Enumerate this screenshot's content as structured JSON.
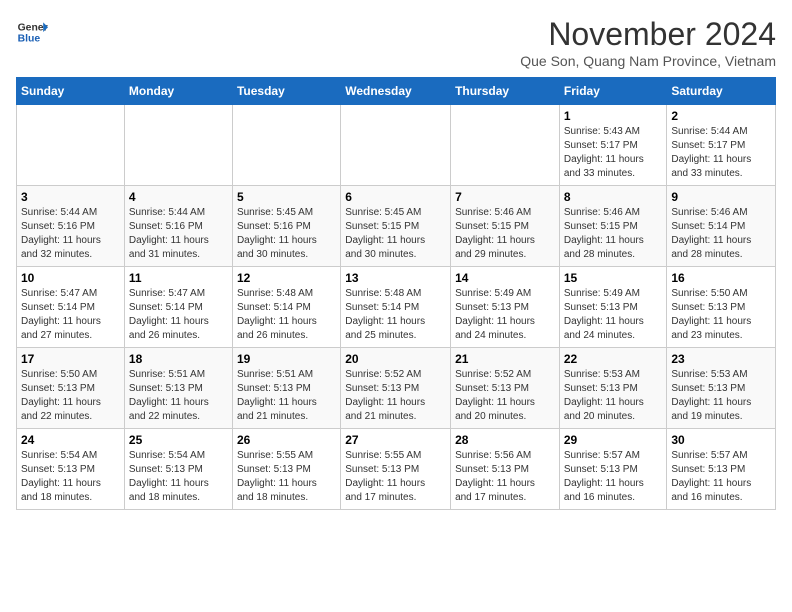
{
  "header": {
    "logo_general": "General",
    "logo_blue": "Blue",
    "month_title": "November 2024",
    "location": "Que Son, Quang Nam Province, Vietnam"
  },
  "days_of_week": [
    "Sunday",
    "Monday",
    "Tuesday",
    "Wednesday",
    "Thursday",
    "Friday",
    "Saturday"
  ],
  "weeks": [
    {
      "id": "week1",
      "days": [
        {
          "date": "",
          "info": "",
          "empty": true
        },
        {
          "date": "",
          "info": "",
          "empty": true
        },
        {
          "date": "",
          "info": "",
          "empty": true
        },
        {
          "date": "",
          "info": "",
          "empty": true
        },
        {
          "date": "",
          "info": "",
          "empty": true
        },
        {
          "date": "1",
          "info": "Sunrise: 5:43 AM\nSunset: 5:17 PM\nDaylight: 11 hours\nand 33 minutes."
        },
        {
          "date": "2",
          "info": "Sunrise: 5:44 AM\nSunset: 5:17 PM\nDaylight: 11 hours\nand 33 minutes."
        }
      ]
    },
    {
      "id": "week2",
      "days": [
        {
          "date": "3",
          "info": "Sunrise: 5:44 AM\nSunset: 5:16 PM\nDaylight: 11 hours\nand 32 minutes."
        },
        {
          "date": "4",
          "info": "Sunrise: 5:44 AM\nSunset: 5:16 PM\nDaylight: 11 hours\nand 31 minutes."
        },
        {
          "date": "5",
          "info": "Sunrise: 5:45 AM\nSunset: 5:16 PM\nDaylight: 11 hours\nand 30 minutes."
        },
        {
          "date": "6",
          "info": "Sunrise: 5:45 AM\nSunset: 5:15 PM\nDaylight: 11 hours\nand 30 minutes."
        },
        {
          "date": "7",
          "info": "Sunrise: 5:46 AM\nSunset: 5:15 PM\nDaylight: 11 hours\nand 29 minutes."
        },
        {
          "date": "8",
          "info": "Sunrise: 5:46 AM\nSunset: 5:15 PM\nDaylight: 11 hours\nand 28 minutes."
        },
        {
          "date": "9",
          "info": "Sunrise: 5:46 AM\nSunset: 5:14 PM\nDaylight: 11 hours\nand 28 minutes."
        }
      ]
    },
    {
      "id": "week3",
      "days": [
        {
          "date": "10",
          "info": "Sunrise: 5:47 AM\nSunset: 5:14 PM\nDaylight: 11 hours\nand 27 minutes."
        },
        {
          "date": "11",
          "info": "Sunrise: 5:47 AM\nSunset: 5:14 PM\nDaylight: 11 hours\nand 26 minutes."
        },
        {
          "date": "12",
          "info": "Sunrise: 5:48 AM\nSunset: 5:14 PM\nDaylight: 11 hours\nand 26 minutes."
        },
        {
          "date": "13",
          "info": "Sunrise: 5:48 AM\nSunset: 5:14 PM\nDaylight: 11 hours\nand 25 minutes."
        },
        {
          "date": "14",
          "info": "Sunrise: 5:49 AM\nSunset: 5:13 PM\nDaylight: 11 hours\nand 24 minutes."
        },
        {
          "date": "15",
          "info": "Sunrise: 5:49 AM\nSunset: 5:13 PM\nDaylight: 11 hours\nand 24 minutes."
        },
        {
          "date": "16",
          "info": "Sunrise: 5:50 AM\nSunset: 5:13 PM\nDaylight: 11 hours\nand 23 minutes."
        }
      ]
    },
    {
      "id": "week4",
      "days": [
        {
          "date": "17",
          "info": "Sunrise: 5:50 AM\nSunset: 5:13 PM\nDaylight: 11 hours\nand 22 minutes."
        },
        {
          "date": "18",
          "info": "Sunrise: 5:51 AM\nSunset: 5:13 PM\nDaylight: 11 hours\nand 22 minutes."
        },
        {
          "date": "19",
          "info": "Sunrise: 5:51 AM\nSunset: 5:13 PM\nDaylight: 11 hours\nand 21 minutes."
        },
        {
          "date": "20",
          "info": "Sunrise: 5:52 AM\nSunset: 5:13 PM\nDaylight: 11 hours\nand 21 minutes."
        },
        {
          "date": "21",
          "info": "Sunrise: 5:52 AM\nSunset: 5:13 PM\nDaylight: 11 hours\nand 20 minutes."
        },
        {
          "date": "22",
          "info": "Sunrise: 5:53 AM\nSunset: 5:13 PM\nDaylight: 11 hours\nand 20 minutes."
        },
        {
          "date": "23",
          "info": "Sunrise: 5:53 AM\nSunset: 5:13 PM\nDaylight: 11 hours\nand 19 minutes."
        }
      ]
    },
    {
      "id": "week5",
      "days": [
        {
          "date": "24",
          "info": "Sunrise: 5:54 AM\nSunset: 5:13 PM\nDaylight: 11 hours\nand 18 minutes."
        },
        {
          "date": "25",
          "info": "Sunrise: 5:54 AM\nSunset: 5:13 PM\nDaylight: 11 hours\nand 18 minutes."
        },
        {
          "date": "26",
          "info": "Sunrise: 5:55 AM\nSunset: 5:13 PM\nDaylight: 11 hours\nand 18 minutes."
        },
        {
          "date": "27",
          "info": "Sunrise: 5:55 AM\nSunset: 5:13 PM\nDaylight: 11 hours\nand 17 minutes."
        },
        {
          "date": "28",
          "info": "Sunrise: 5:56 AM\nSunset: 5:13 PM\nDaylight: 11 hours\nand 17 minutes."
        },
        {
          "date": "29",
          "info": "Sunrise: 5:57 AM\nSunset: 5:13 PM\nDaylight: 11 hours\nand 16 minutes."
        },
        {
          "date": "30",
          "info": "Sunrise: 5:57 AM\nSunset: 5:13 PM\nDaylight: 11 hours\nand 16 minutes."
        }
      ]
    }
  ]
}
